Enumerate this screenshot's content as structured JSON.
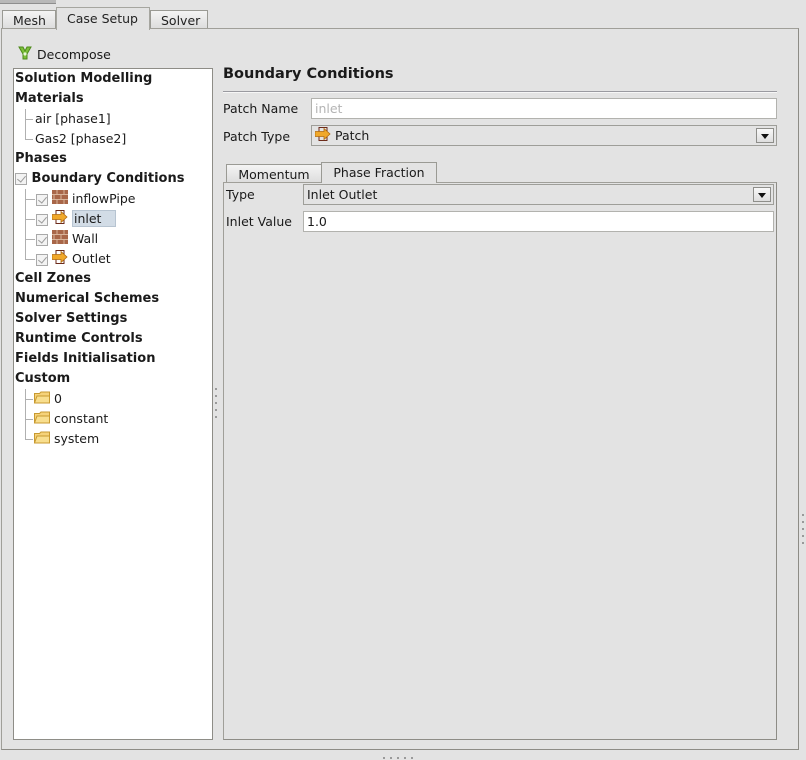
{
  "tabs": [
    {
      "label": "Mesh",
      "active": false
    },
    {
      "label": "Case Setup",
      "active": true
    },
    {
      "label": "Solver",
      "active": false
    }
  ],
  "toolbar": {
    "decompose_label": "Decompose",
    "decompose_icon": "decompose-icon"
  },
  "tree": {
    "solution_modelling": "Solution Modelling",
    "materials": {
      "label": "Materials",
      "children": [
        "air [phase1]",
        "Gas2 [phase2]"
      ]
    },
    "phases": "Phases",
    "boundary_conditions": {
      "label": "Boundary Conditions",
      "checked": true,
      "children": [
        {
          "label": "inflowPipe",
          "checked": true,
          "icon": "wall-icon",
          "selected": false
        },
        {
          "label": "inlet",
          "checked": true,
          "icon": "patch-icon",
          "selected": true
        },
        {
          "label": "Wall",
          "checked": true,
          "icon": "wall-icon",
          "selected": false
        },
        {
          "label": "Outlet",
          "checked": true,
          "icon": "patch-icon",
          "selected": false
        }
      ]
    },
    "cell_zones": "Cell Zones",
    "numerical_schemes": "Numerical Schemes",
    "solver_settings": "Solver Settings",
    "runtime_controls": "Runtime Controls",
    "fields_initialisation": "Fields Initialisation",
    "custom": {
      "label": "Custom",
      "children": [
        "0",
        "constant",
        "system"
      ]
    }
  },
  "panel": {
    "title": "Boundary Conditions",
    "patch_name_label": "Patch Name",
    "patch_name_value": "inlet",
    "patch_type_label": "Patch Type",
    "patch_type_value": "Patch",
    "subtabs": [
      {
        "label": "Momentum",
        "active": false
      },
      {
        "label": "Phase Fraction",
        "active": true
      }
    ],
    "type_label": "Type",
    "type_value": "Inlet Outlet",
    "inlet_value_label": "Inlet Value",
    "inlet_value": "1.0"
  },
  "colors": {
    "background": "#e3e3e3",
    "selection": "#d2dce6",
    "brick": "#a0553c",
    "patch_arrow": "#e8a020",
    "folder": "#f1c55a",
    "decompose_green": "#6fb52c"
  }
}
